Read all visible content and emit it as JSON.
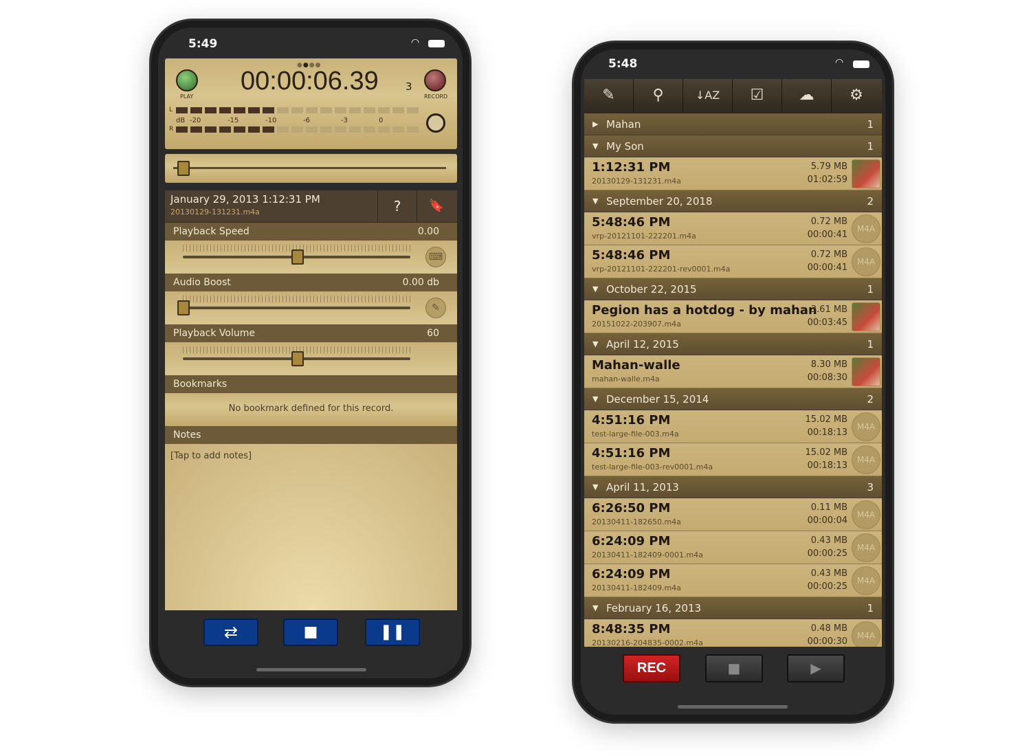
{
  "left_phone": {
    "status_time": "5:49",
    "meter": {
      "time": "00:00:06.39",
      "count": "3",
      "play_label": "PLAY",
      "record_label": "RECORD",
      "db_label": "dB",
      "scale": [
        "-20",
        "-15",
        "-10",
        "-6",
        "-3",
        "0"
      ],
      "l": "L",
      "r": "R",
      "page_index": 2,
      "page_count": 4,
      "left_level_fraction": 0.4,
      "right_level_fraction": 0.4
    },
    "position_fraction": 0.02,
    "record": {
      "title": "January 29, 2013 1:12:31 PM",
      "file": "20130129-131231.m4a"
    },
    "speed": {
      "label": "Playback Speed",
      "value": "0.00",
      "fraction": 0.5
    },
    "boost": {
      "label": "Audio Boost",
      "value": "0.00 db",
      "fraction": 0.0
    },
    "volume": {
      "label": "Playback Volume",
      "value": "60",
      "fraction": 0.5
    },
    "bookmarks": {
      "label": "Bookmarks",
      "empty": "No bookmark defined for this record."
    },
    "notes": {
      "label": "Notes",
      "placeholder": "[Tap to add notes]"
    },
    "colors": {
      "button_blue": "#0b3a8c",
      "gold": "#d0bb85",
      "band": "#6c5a38"
    }
  },
  "right_phone": {
    "status_time": "5:48",
    "toolbar": [
      "edit-icon",
      "search-icon",
      "sort-az-icon",
      "checkbox-icon",
      "cloud-icon",
      "gear-icon"
    ],
    "groups": [
      {
        "name": "Mahan",
        "count": "1",
        "expanded": false,
        "items": []
      },
      {
        "name": "My Son",
        "count": "1",
        "expanded": true,
        "items": [
          {
            "title": "1:12:31 PM",
            "file": "20130129-131231.m4a",
            "size": "5.79 MB",
            "duration": "01:02:59",
            "thumb": "photo"
          }
        ]
      },
      {
        "name": "September 20, 2018",
        "count": "2",
        "expanded": true,
        "items": [
          {
            "title": "5:48:46 PM",
            "file": "vrp-20121101-222201.m4a",
            "size": "0.72 MB",
            "duration": "00:00:41",
            "thumb": "M4A"
          },
          {
            "title": "5:48:46 PM",
            "file": "vrp-20121101-222201-rev0001.m4a",
            "size": "0.72 MB",
            "duration": "00:00:41",
            "thumb": "M4A"
          }
        ]
      },
      {
        "name": "October 22, 2015",
        "count": "1",
        "expanded": true,
        "items": [
          {
            "title": "Pegion has a hotdog - by mahan",
            "file": "20151022-203907.m4a",
            "size": "3.61 MB",
            "duration": "00:03:45",
            "thumb": "photo"
          }
        ]
      },
      {
        "name": "April 12, 2015",
        "count": "1",
        "expanded": true,
        "items": [
          {
            "title": "Mahan-walle",
            "file": "mahan-walle.m4a",
            "size": "8.30 MB",
            "duration": "00:08:30",
            "thumb": "photo"
          }
        ]
      },
      {
        "name": "December 15, 2014",
        "count": "2",
        "expanded": true,
        "items": [
          {
            "title": "4:51:16 PM",
            "file": "test-large-file-003.m4a",
            "size": "15.02 MB",
            "duration": "00:18:13",
            "thumb": "M4A"
          },
          {
            "title": "4:51:16 PM",
            "file": "test-large-file-003-rev0001.m4a",
            "size": "15.02 MB",
            "duration": "00:18:13",
            "thumb": "M4A"
          }
        ]
      },
      {
        "name": "April 11, 2013",
        "count": "3",
        "expanded": true,
        "items": [
          {
            "title": "6:26:50 PM",
            "file": "20130411-182650.m4a",
            "size": "0.11 MB",
            "duration": "00:00:04",
            "thumb": "M4A"
          },
          {
            "title": "6:24:09 PM",
            "file": "20130411-182409-0001.m4a",
            "size": "0.43 MB",
            "duration": "00:00:25",
            "thumb": "M4A"
          },
          {
            "title": "6:24:09 PM",
            "file": "20130411-182409.m4a",
            "size": "0.43 MB",
            "duration": "00:00:25",
            "thumb": "M4A"
          }
        ]
      },
      {
        "name": "February 16, 2013",
        "count": "1",
        "expanded": true,
        "items": [
          {
            "title": "8:48:35 PM",
            "file": "20130216-204835-0002.m4a",
            "size": "0.48 MB",
            "duration": "00:00:30",
            "thumb": "M4A"
          }
        ]
      }
    ],
    "rec_label": "REC",
    "colors": {
      "rec_red": "#b01818"
    }
  }
}
